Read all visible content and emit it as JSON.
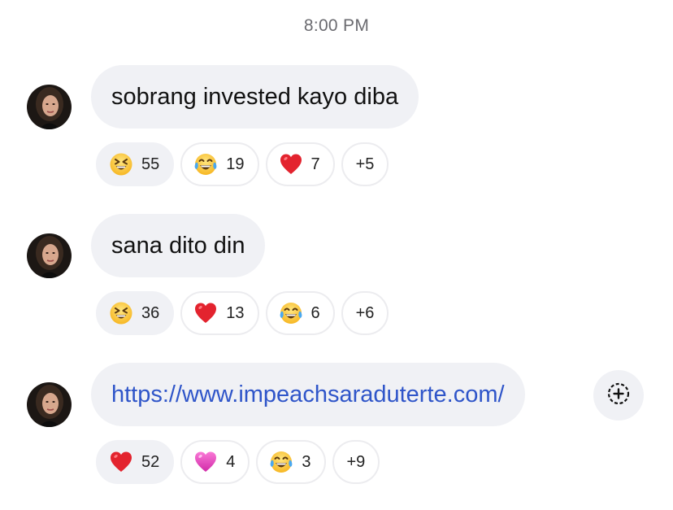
{
  "timestamp": "8:00 PM",
  "messages": [
    {
      "text": "sobrang invested kayo diba",
      "reactions": [
        {
          "emoji": "grinning-squint-face",
          "count": "55"
        },
        {
          "emoji": "tears-of-joy-face",
          "count": "19"
        },
        {
          "emoji": "red-heart",
          "count": "7"
        }
      ],
      "more": "+5"
    },
    {
      "text": "sana dito din",
      "reactions": [
        {
          "emoji": "grinning-squint-face",
          "count": "36"
        },
        {
          "emoji": "red-heart",
          "count": "13"
        },
        {
          "emoji": "tears-of-joy-face",
          "count": "6"
        }
      ],
      "more": "+6"
    },
    {
      "text": "https://www.impeachsaraduterte.com/",
      "is_link": true,
      "reactions": [
        {
          "emoji": "red-heart",
          "count": "52"
        },
        {
          "emoji": "pink-heart",
          "count": "4"
        },
        {
          "emoji": "tears-of-joy-face",
          "count": "3"
        }
      ],
      "more": "+9"
    }
  ],
  "colors": {
    "bubble": "#f0f1f5",
    "link": "#2f55c9",
    "timestamp": "#6b6b70"
  },
  "add_reaction_icon": "add-reaction-icon"
}
